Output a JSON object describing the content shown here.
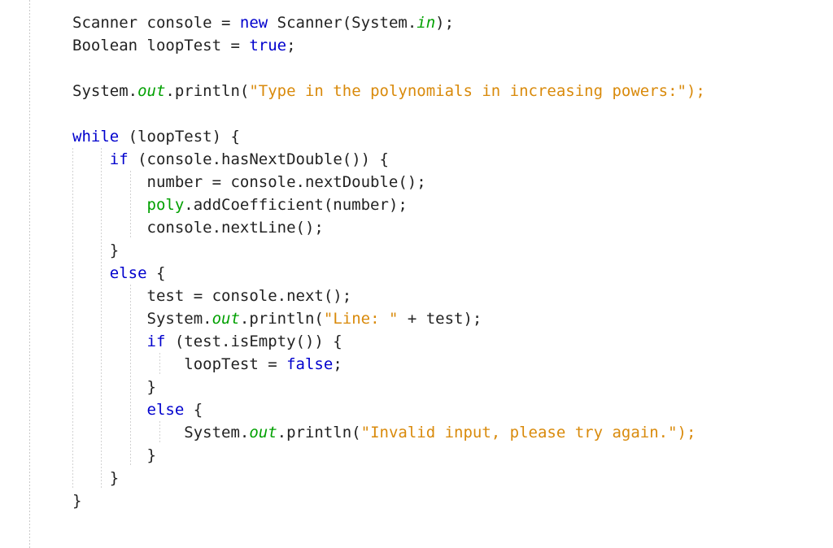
{
  "editor": {
    "language": "java",
    "background_color": "#ffffff",
    "text_color": "#222222",
    "gutter_guide_color": "#c9c9c9",
    "indent_guide_color": "#d2d2d2",
    "font_size_px": 19,
    "line_height_px": 28,
    "indent_width_chars": 4,
    "theme_colors": {
      "keyword": "#0000CD",
      "field": "#00A000",
      "string": "#D98A0B",
      "plain": "#222222"
    },
    "indent_guides_x": [
      89,
      124,
      160,
      196
    ],
    "lines": [
      {
        "n": 1,
        "text": "Scanner console = new Scanner(System.in);",
        "tokens": [
          {
            "t": "Scanner console = ",
            "k": "pln"
          },
          {
            "t": "new",
            "k": "kw"
          },
          {
            "t": " Scanner(System.",
            "k": "pln"
          },
          {
            "t": "in",
            "k": "fldi"
          },
          {
            "t": ");",
            "k": "pln"
          }
        ]
      },
      {
        "n": 2,
        "text": "Boolean loopTest = true;",
        "tokens": [
          {
            "t": "Boolean loopTest = ",
            "k": "pln"
          },
          {
            "t": "true",
            "k": "kw"
          },
          {
            "t": ";",
            "k": "pln"
          }
        ]
      },
      {
        "n": 3,
        "text": "",
        "tokens": []
      },
      {
        "n": 4,
        "text": "System.out.println(\"Type in the polynomials in increasing powers:\");",
        "tokens": [
          {
            "t": "System.",
            "k": "pln"
          },
          {
            "t": "out",
            "k": "fldi"
          },
          {
            "t": ".println(",
            "k": "pln"
          },
          {
            "t": "\"Type in the polynomials in increasing powers:\");",
            "k": "str"
          }
        ]
      },
      {
        "n": 5,
        "text": "",
        "tokens": []
      },
      {
        "n": 6,
        "text": "while (loopTest) {",
        "tokens": [
          {
            "t": "while",
            "k": "kw"
          },
          {
            "t": " (loopTest) {",
            "k": "pln"
          }
        ]
      },
      {
        "n": 7,
        "text": "    if (console.hasNextDouble()) {",
        "tokens": [
          {
            "t": "    ",
            "k": "pln"
          },
          {
            "t": "if",
            "k": "kw"
          },
          {
            "t": " (console.hasNextDouble()) {",
            "k": "pln"
          }
        ]
      },
      {
        "n": 8,
        "text": "        number = console.nextDouble();",
        "tokens": [
          {
            "t": "        number = console.nextDouble();",
            "k": "pln"
          }
        ]
      },
      {
        "n": 9,
        "text": "        poly.addCoefficient(number);",
        "tokens": [
          {
            "t": "        ",
            "k": "pln"
          },
          {
            "t": "poly",
            "k": "fld"
          },
          {
            "t": ".addCoefficient(number);",
            "k": "pln"
          }
        ]
      },
      {
        "n": 10,
        "text": "        console.nextLine();",
        "tokens": [
          {
            "t": "        console.nextLine();",
            "k": "pln"
          }
        ]
      },
      {
        "n": 11,
        "text": "    }",
        "tokens": [
          {
            "t": "    }",
            "k": "pln"
          }
        ]
      },
      {
        "n": 12,
        "text": "    else {",
        "tokens": [
          {
            "t": "    ",
            "k": "pln"
          },
          {
            "t": "else",
            "k": "kw"
          },
          {
            "t": " {",
            "k": "pln"
          }
        ]
      },
      {
        "n": 13,
        "text": "        test = console.next();",
        "tokens": [
          {
            "t": "        test = console.next();",
            "k": "pln"
          }
        ]
      },
      {
        "n": 14,
        "text": "        System.out.println(\"Line: \" + test);",
        "tokens": [
          {
            "t": "        System.",
            "k": "pln"
          },
          {
            "t": "out",
            "k": "fldi"
          },
          {
            "t": ".println(",
            "k": "pln"
          },
          {
            "t": "\"Line: \"",
            "k": "str"
          },
          {
            "t": " + test);",
            "k": "pln"
          }
        ]
      },
      {
        "n": 15,
        "text": "        if (test.isEmpty()) {",
        "tokens": [
          {
            "t": "        ",
            "k": "pln"
          },
          {
            "t": "if",
            "k": "kw"
          },
          {
            "t": " (test.isEmpty()) {",
            "k": "pln"
          }
        ]
      },
      {
        "n": 16,
        "text": "            loopTest = false;",
        "tokens": [
          {
            "t": "            loopTest = ",
            "k": "pln"
          },
          {
            "t": "false",
            "k": "kw"
          },
          {
            "t": ";",
            "k": "pln"
          }
        ]
      },
      {
        "n": 17,
        "text": "        }",
        "tokens": [
          {
            "t": "        }",
            "k": "pln"
          }
        ]
      },
      {
        "n": 18,
        "text": "        else {",
        "tokens": [
          {
            "t": "        ",
            "k": "pln"
          },
          {
            "t": "else",
            "k": "kw"
          },
          {
            "t": " {",
            "k": "pln"
          }
        ]
      },
      {
        "n": 19,
        "text": "            System.out.println(\"Invalid input, please try again.\");",
        "tokens": [
          {
            "t": "            System.",
            "k": "pln"
          },
          {
            "t": "out",
            "k": "fldi"
          },
          {
            "t": ".println(",
            "k": "pln"
          },
          {
            "t": "\"Invalid input, please try again.\");",
            "k": "str"
          }
        ]
      },
      {
        "n": 20,
        "text": "        }",
        "tokens": [
          {
            "t": "        }",
            "k": "pln"
          }
        ]
      },
      {
        "n": 21,
        "text": "    }",
        "tokens": [
          {
            "t": "    }",
            "k": "pln"
          }
        ]
      },
      {
        "n": 22,
        "text": "}",
        "tokens": [
          {
            "t": "}",
            "k": "pln"
          }
        ]
      }
    ]
  }
}
